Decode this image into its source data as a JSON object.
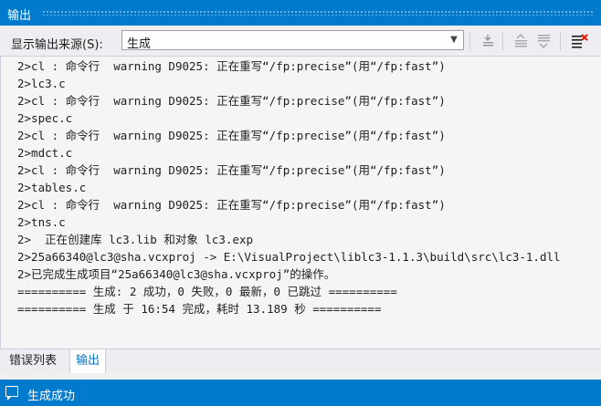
{
  "panel": {
    "title": "输出"
  },
  "toolbar": {
    "show_output_label": "显示输出来源(S):",
    "source_selected": "生成"
  },
  "icons": {
    "dropdown": "chevron-down-icon",
    "goto_output": "find-message-icon",
    "prev_message": "previous-message-icon",
    "next_message": "next-message-icon",
    "clear_all": "clear-all-icon",
    "status": "comment-icon"
  },
  "output": {
    "lines": [
      "2>cl : 命令行  warning D9025: 正在重写“/fp:precise”(用“/fp:fast”)",
      "2>lc3.c",
      "2>cl : 命令行  warning D9025: 正在重写“/fp:precise”(用“/fp:fast”)",
      "2>spec.c",
      "2>cl : 命令行  warning D9025: 正在重写“/fp:precise”(用“/fp:fast”)",
      "2>mdct.c",
      "2>cl : 命令行  warning D9025: 正在重写“/fp:precise”(用“/fp:fast”)",
      "2>tables.c",
      "2>cl : 命令行  warning D9025: 正在重写“/fp:precise”(用“/fp:fast”)",
      "2>tns.c",
      "2>  正在创建库 lc3.lib 和对象 lc3.exp",
      "2>25a66340@lc3@sha.vcxproj -> E:\\VisualProject\\liblc3-1.1.3\\build\\src\\lc3-1.dll",
      "2>已完成生成项目“25a66340@lc3@sha.vcxproj”的操作。",
      "========== 生成: 2 成功，0 失败，0 最新，0 已跳过 ==========",
      "========== 生成 于 16:54 完成，耗时 13.189 秒 =========="
    ]
  },
  "tabs": [
    {
      "label": "错误列表",
      "active": false
    },
    {
      "label": "输出",
      "active": true
    }
  ],
  "status": {
    "text": "生成成功"
  },
  "colors": {
    "accent": "#007acc",
    "tab_active_text": "#0e70c0",
    "panel_bg": "#f5f5f5"
  }
}
